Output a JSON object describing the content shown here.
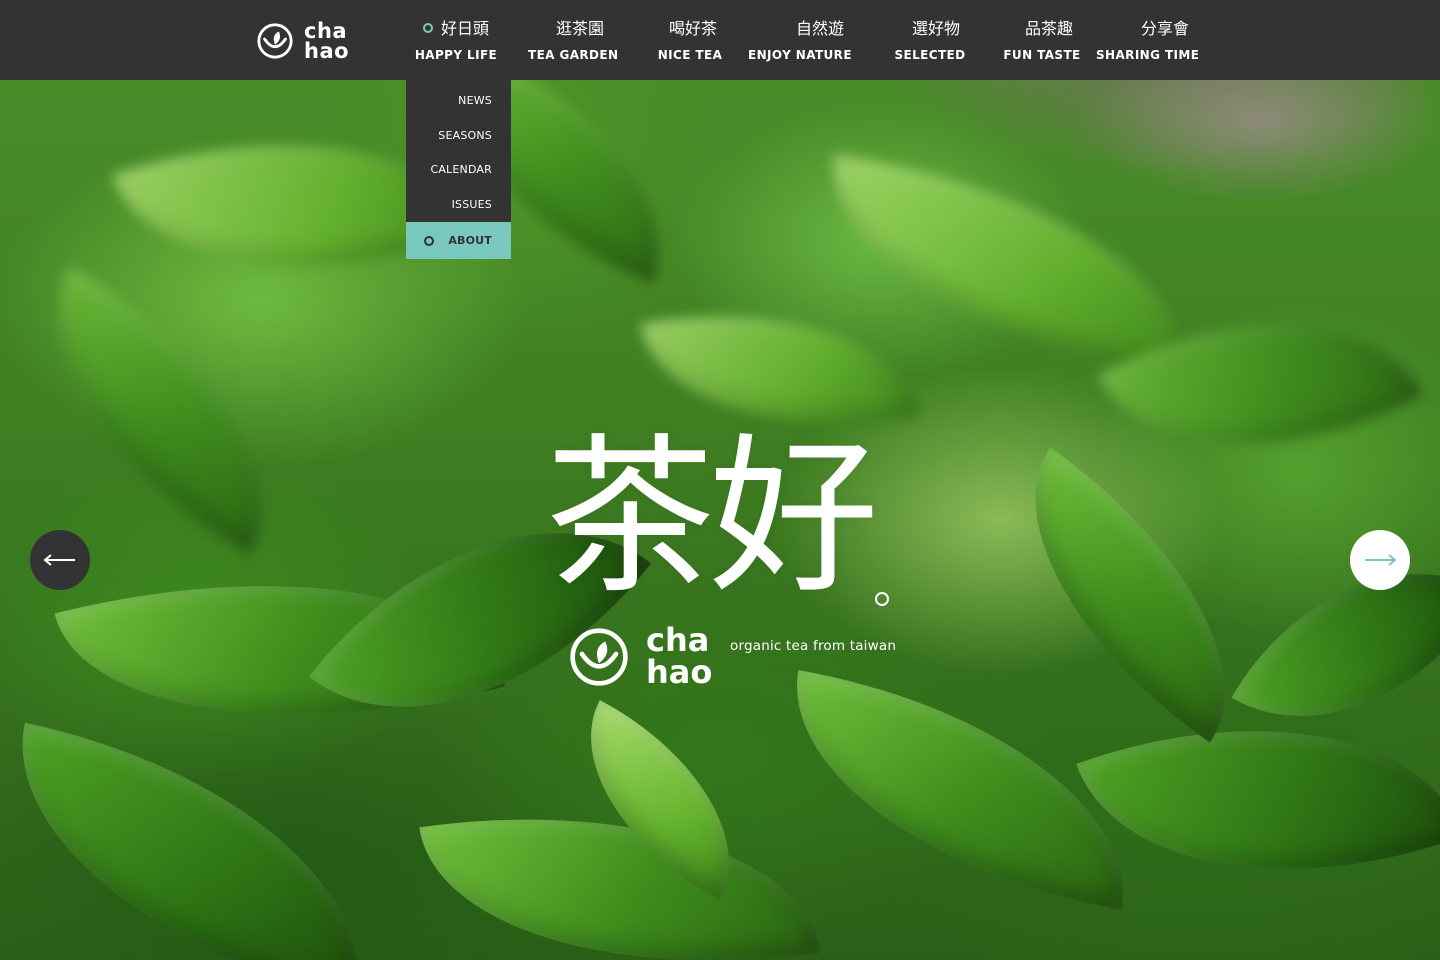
{
  "brand": {
    "line1": "cha",
    "line2": "hao"
  },
  "nav": {
    "items": [
      {
        "zh": "好日頭",
        "en": "HAPPY LIFE",
        "active": true
      },
      {
        "zh": "逛茶園",
        "en": "TEA GARDEN"
      },
      {
        "zh": "喝好茶",
        "en": "NICE TEA"
      },
      {
        "zh": "自然遊",
        "en": "ENJOY NATURE"
      },
      {
        "zh": "選好物",
        "en": "SELECTED"
      },
      {
        "zh": "品茶趣",
        "en": "FUN TASTE"
      },
      {
        "zh": "分享會",
        "en": "SHARING TIME"
      }
    ]
  },
  "dropdown": {
    "items": [
      "NEWS",
      "SEASONS",
      "CALENDAR",
      "ISSUES",
      "ABOUT"
    ],
    "selected": "ABOUT"
  },
  "hero": {
    "title": "茶好",
    "brand_line1": "cha",
    "brand_line2": "hao",
    "tagline": "organic tea from taiwan"
  },
  "icons": {
    "logo": "teacup-leaf-logo-icon",
    "prev": "arrow-left-icon",
    "next": "arrow-right-icon",
    "active_marker": "ring-icon"
  },
  "colors": {
    "topbar": "#333333",
    "accent": "#79c8be",
    "text": "#ffffff"
  }
}
